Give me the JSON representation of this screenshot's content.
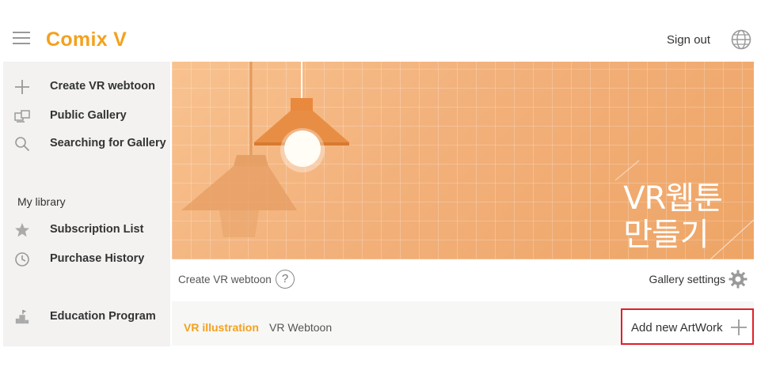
{
  "app": {
    "logo": "Comix V",
    "sign_out_label": "Sign out"
  },
  "sidebar": {
    "items": [
      {
        "label": "Create VR webtoon",
        "icon": "plus-icon"
      },
      {
        "label": "Public Gallery",
        "icon": "gallery-icon"
      },
      {
        "label": "Searching for Gallery",
        "icon": "search-icon"
      }
    ],
    "library_title": "My library",
    "library_items": [
      {
        "label": "Subscription List",
        "icon": "star-icon"
      },
      {
        "label": "Purchase History",
        "icon": "clock-icon"
      }
    ],
    "education": {
      "label": "Education Program",
      "icon": "podium-icon"
    }
  },
  "banner": {
    "line1": "VR웹툰",
    "line2": "만들기"
  },
  "info_bar": {
    "create_label": "Create VR webtoon",
    "help_glyph": "?",
    "gallery_settings_label": "Gallery settings"
  },
  "tabs": {
    "active": "VR illustration",
    "other": "VR Webtoon"
  },
  "add_artwork_label": "Add new ArtWork",
  "colors": {
    "brand": "#f4a11e",
    "highlight_border": "#e0202a",
    "sidebar_bg": "#f3f2f1",
    "banner": "#f2b07a"
  }
}
